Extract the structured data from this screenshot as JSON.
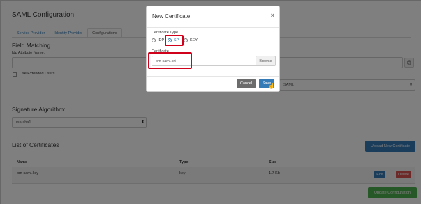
{
  "page": {
    "title": "SAML Configuration",
    "tabs": [
      {
        "label": "Service Provider"
      },
      {
        "label": "Identity Provider"
      },
      {
        "label": "Configurations"
      }
    ],
    "field_matching": {
      "heading": "Field Matching",
      "idp_attr_label": "Idp Attribute Name:",
      "at_sign": "@",
      "use_extended_label": "Use Extended Users",
      "select_value": "SAML"
    },
    "signature": {
      "heading": "Signature Algorithm:",
      "value": "rsa-sha1"
    },
    "certificates": {
      "heading": "List of Certificates",
      "upload_label": "Upload New Certificate",
      "columns": [
        "Name",
        "Type",
        "Size"
      ],
      "rows": [
        {
          "name": "pm-saml.key",
          "type": "key",
          "size": "1.7 Kb",
          "edit": "Edit",
          "delete": "Delete"
        }
      ],
      "update_label": "Update Configuration"
    }
  },
  "modal": {
    "title": "New Certificate",
    "close": "×",
    "type_label": "Certificate Type",
    "options": [
      {
        "label": "IDP",
        "checked": false
      },
      {
        "label": "SP",
        "checked": true
      },
      {
        "label": "KEY",
        "checked": false
      }
    ],
    "cert_label": "Certificate",
    "cert_value": "pm-saml.crt",
    "browse_label": "Browse",
    "cancel_label": "Cancel",
    "save_label": "Save"
  },
  "colors": {
    "primary": "#337ab7",
    "success": "#4cae4c",
    "danger": "#d9534f",
    "highlight": "#d0021b"
  }
}
